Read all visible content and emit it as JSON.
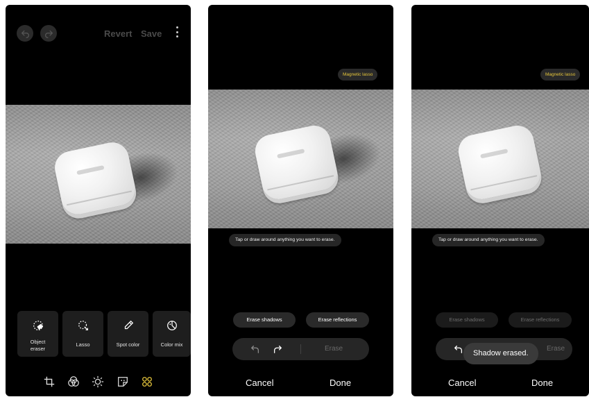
{
  "screen1": {
    "top_bar": {
      "revert_label": "Revert",
      "save_label": "Save"
    },
    "tools": [
      {
        "label_line1": "Object",
        "label_line2": "eraser",
        "icon": "object-eraser-icon"
      },
      {
        "label": "Lasso",
        "icon": "lasso-icon"
      },
      {
        "label": "Spot color",
        "icon": "eyedropper-icon"
      },
      {
        "label": "Color mix",
        "icon": "color-mix-icon"
      }
    ],
    "bottom_nav": [
      "transform-icon",
      "filters-icon",
      "brightness-icon",
      "sticker-icon",
      "more-tools-icon"
    ],
    "accent_color": "#e6c63c"
  },
  "screen2": {
    "mode_badge": "Magnetic lasso",
    "hint": "Tap or draw around anything you want to erase.",
    "chips": {
      "erase_shadows": "Erase shadows",
      "erase_reflections": "Erase reflections"
    },
    "control": {
      "erase_label": "Erase"
    },
    "footer": {
      "cancel": "Cancel",
      "done": "Done"
    }
  },
  "screen3": {
    "mode_badge": "Magnetic lasso",
    "hint": "Tap or draw around anything you want to erase.",
    "chips": {
      "erase_shadows": "Erase shadows",
      "erase_reflections": "Erase reflections"
    },
    "control": {
      "erase_label": "Erase"
    },
    "toast": "Shadow erased.",
    "footer": {
      "cancel": "Cancel",
      "done": "Done"
    }
  }
}
